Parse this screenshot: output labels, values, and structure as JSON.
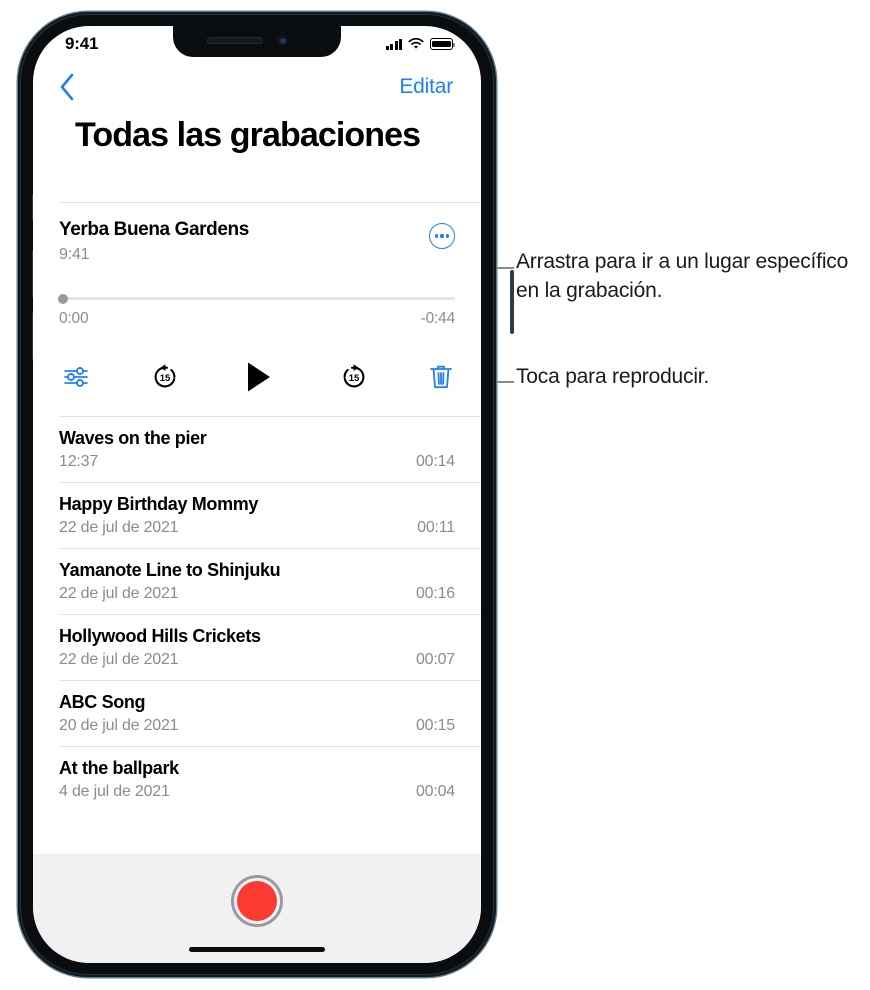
{
  "status_bar": {
    "time": "9:41",
    "cellular_icon": "signal-bars-icon",
    "wifi_icon": "wifi-icon",
    "battery_icon": "battery-icon"
  },
  "nav_bar": {
    "back_icon": "chevron-left-icon",
    "edit_label": "Editar"
  },
  "header": {
    "title": "Todas las grabaciones"
  },
  "player": {
    "title": "Yerba Buena Gardens",
    "date": "9:41",
    "more_icon": "ellipsis-circle-icon",
    "elapsed": "0:00",
    "remaining": "-0:44",
    "progress_percent": 0,
    "controls": [
      {
        "name": "playback-settings",
        "icon": "sliders-icon",
        "color": "#2080f7"
      },
      {
        "name": "skip-back-15",
        "icon": "rewind-15-icon",
        "label": "15",
        "color": "#000000"
      },
      {
        "name": "play",
        "icon": "play-icon",
        "color": "#000000"
      },
      {
        "name": "skip-forward-15",
        "icon": "forward-15-icon",
        "label": "15",
        "color": "#000000"
      },
      {
        "name": "delete",
        "icon": "trash-icon",
        "color": "#2080f7"
      }
    ]
  },
  "recordings": [
    {
      "name": "Waves on the pier",
      "date": "12:37",
      "duration": "00:14"
    },
    {
      "name": "Happy Birthday Mommy",
      "date": "22 de jul de 2021",
      "duration": "00:11"
    },
    {
      "name": "Yamanote Line to Shinjuku",
      "date": "22 de jul de 2021",
      "duration": "00:16"
    },
    {
      "name": "Hollywood Hills Crickets",
      "date": "22 de jul de 2021",
      "duration": "00:07"
    },
    {
      "name": "ABC Song",
      "date": "20 de jul de 2021",
      "duration": "00:15"
    },
    {
      "name": "At the ballpark",
      "date": "4 de jul de 2021",
      "duration": "00:04"
    }
  ],
  "record_bar": {
    "record_button_icon": "record-icon",
    "record_color": "#fb3b30",
    "home_indicator": "home-indicator"
  },
  "callouts": {
    "scrubber": "Arrastra para ir a un lugar específico en la grabación.",
    "play": "Toca para reproducir."
  },
  "colors": {
    "accent_blue": "#2080f7",
    "record_red": "#fb3b30",
    "secondary_text": "#8b8b90",
    "separator": "#e2e2e4",
    "bottom_bar": "#f1f1f3"
  }
}
